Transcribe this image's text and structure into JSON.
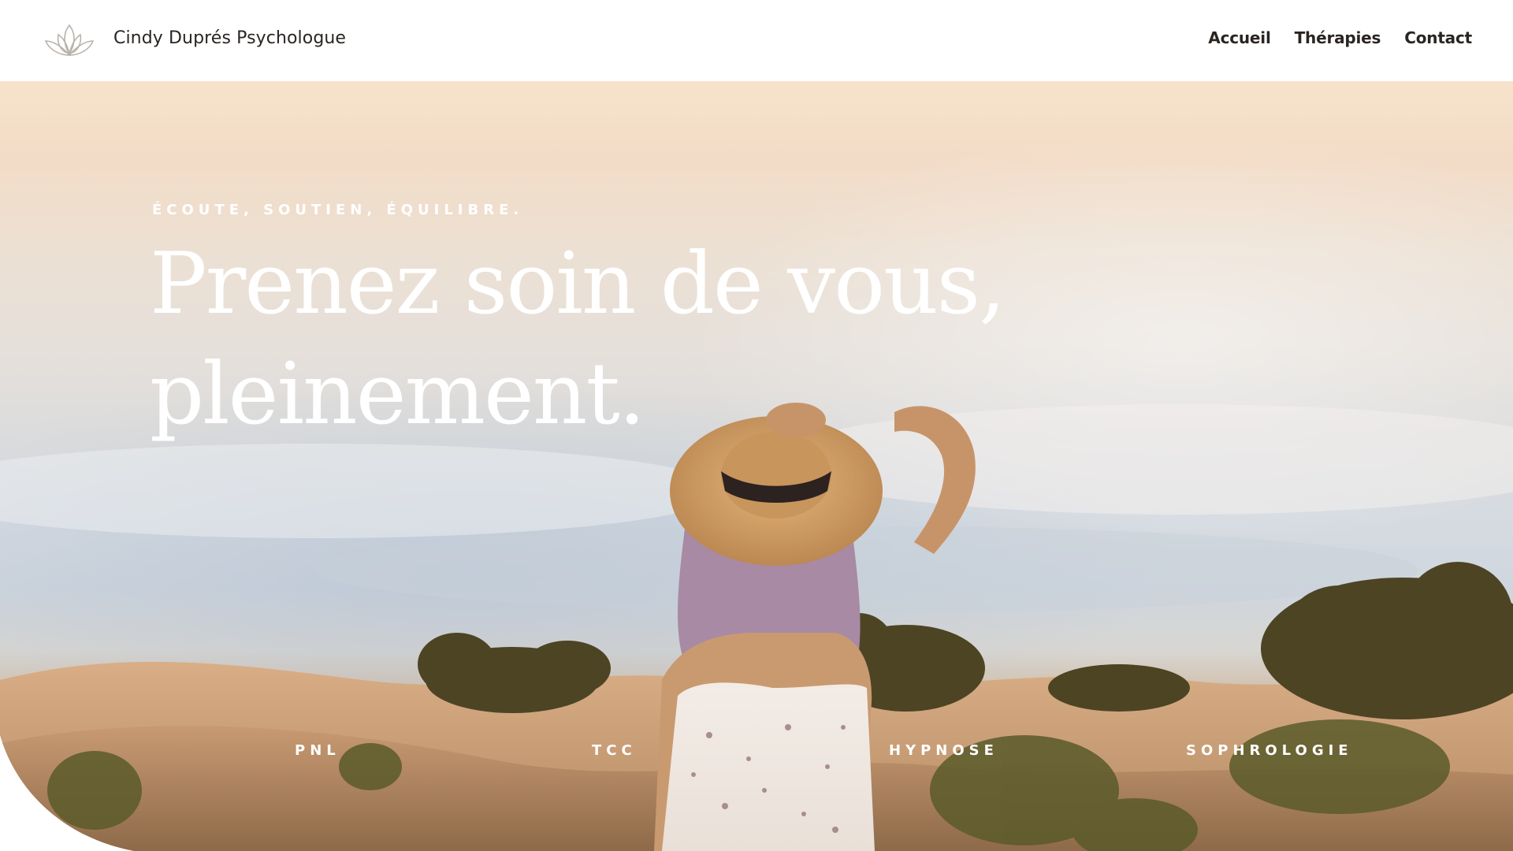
{
  "header": {
    "brand": "Cindy Duprés Psychologue",
    "logo_icon": "lotus-icon",
    "nav": [
      {
        "label": "Accueil"
      },
      {
        "label": "Thérapies"
      },
      {
        "label": "Contact"
      }
    ]
  },
  "hero": {
    "tagline": "ÉCOUTE, SOUTIEN, ÉQUILIBRE.",
    "headline_line1": "Prenez soin de vous,",
    "headline_line2": "pleinement.",
    "therapies": [
      {
        "label": "PNL"
      },
      {
        "label": "TCC"
      },
      {
        "label": "HYPNOSE"
      },
      {
        "label": "SOPHROLOGIE"
      }
    ]
  },
  "colors": {
    "text_dark": "#2a2522",
    "hero_text": "#ffffff",
    "logo_stroke": "#b9b2aa"
  }
}
